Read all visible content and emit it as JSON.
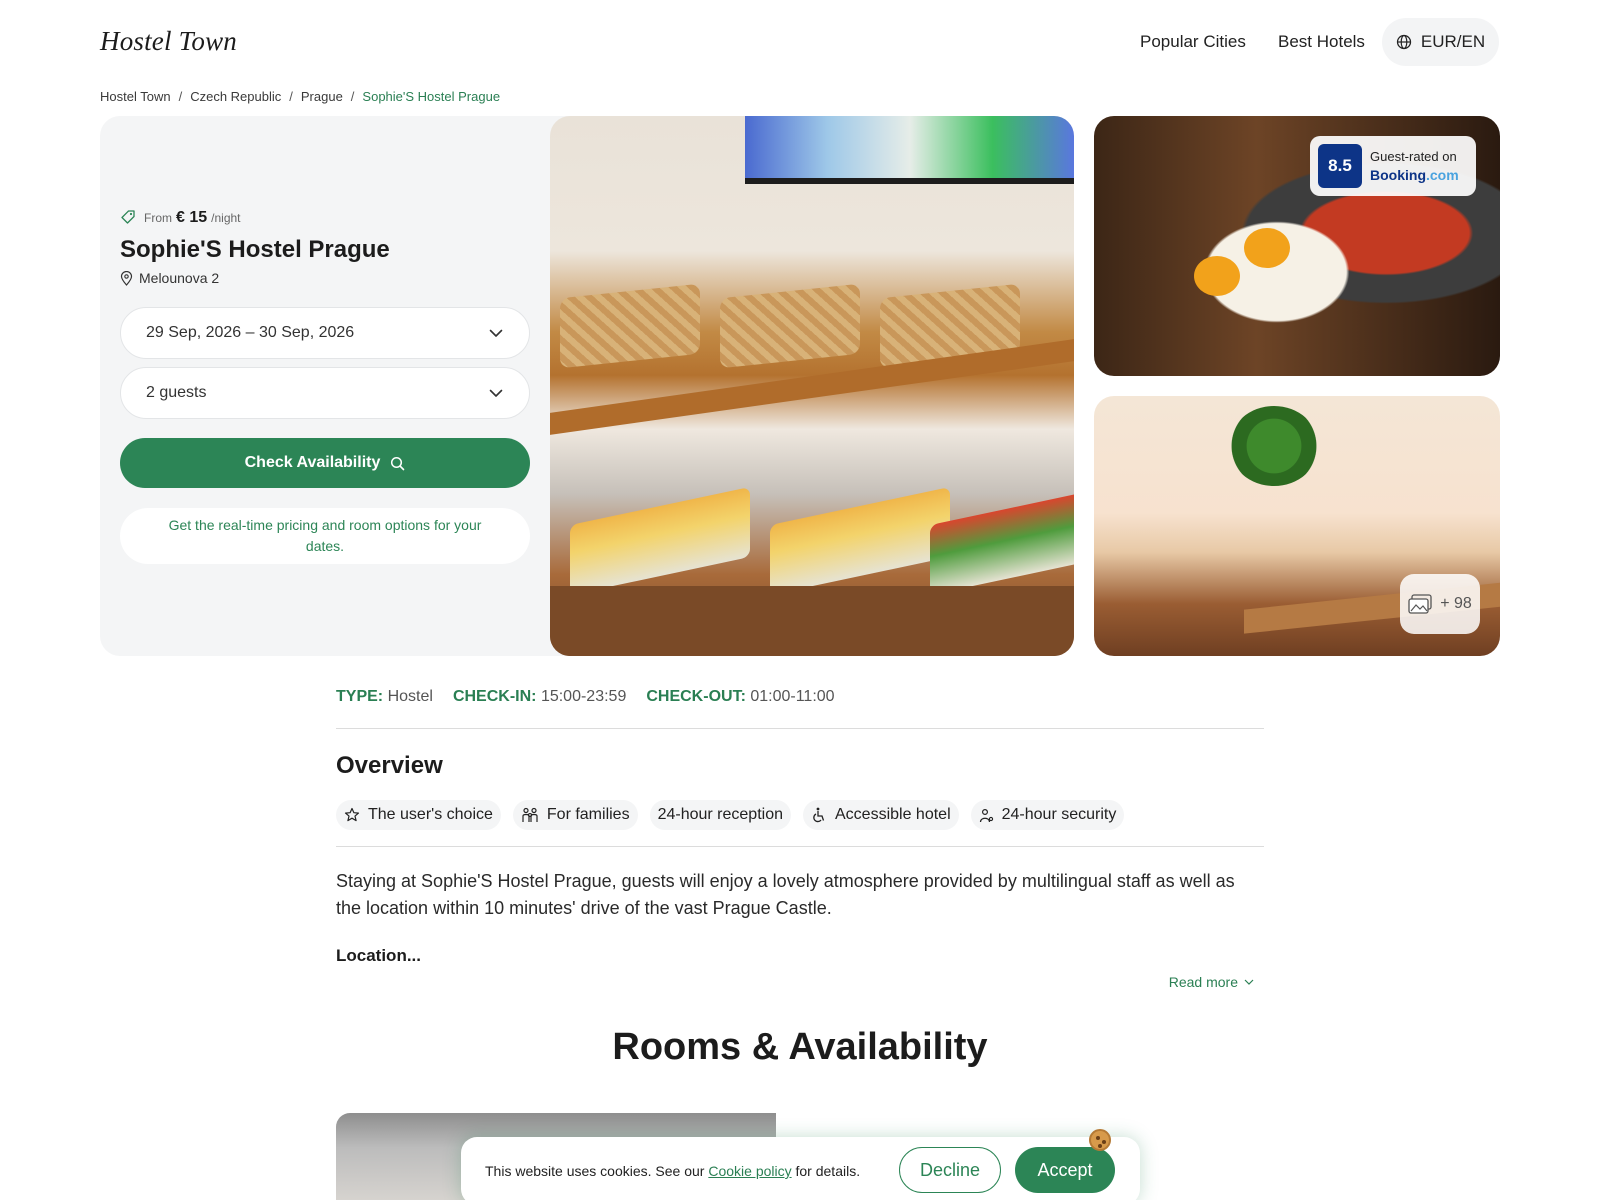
{
  "header": {
    "logo": "Hostel Town",
    "nav": [
      "Popular Cities",
      "Best Hotels"
    ],
    "lang": "EUR/EN"
  },
  "breadcrumb": [
    "Hostel Town",
    "Czech Republic",
    "Prague",
    "Sophie'S Hostel Prague"
  ],
  "booking": {
    "from_label": "From",
    "price": "€ 15",
    "per_night": "/night",
    "hotel_name": "Sophie'S Hostel Prague",
    "address": "Melounova 2",
    "dates": "29 Sep, 2026 – 30 Sep, 2026",
    "guests": "2 guests",
    "check_button": "Check Availability",
    "note": "Get the real-time pricing and room options for your dates."
  },
  "gallery": {
    "rating_score": "8.5",
    "rating_label": "Guest-rated on",
    "rating_brand": "Booking",
    "rating_brand_suffix": ".com",
    "more_count": "+ 98"
  },
  "facts": [
    {
      "key": "TYPE:",
      "value": "Hostel"
    },
    {
      "key": "CHECK-IN:",
      "value": "15:00-23:59"
    },
    {
      "key": "CHECK-OUT:",
      "value": "01:00-11:00"
    }
  ],
  "overview": {
    "title": "Overview",
    "chips": [
      {
        "icon": "star-icon",
        "label": "The user's choice"
      },
      {
        "icon": "family-icon",
        "label": "For families"
      },
      {
        "icon": "",
        "label": "24-hour reception"
      },
      {
        "icon": "accessible-icon",
        "label": "Accessible hotel"
      },
      {
        "icon": "security-icon",
        "label": "24-hour security"
      }
    ],
    "description": "Staying at Sophie'S Hostel Prague, guests will enjoy a lovely atmosphere provided by multilingual staff as well as the location within 10 minutes' drive of the vast Prague Castle.",
    "location_label": "Location...",
    "read_more": "Read more"
  },
  "rooms": {
    "title": "Rooms & Availability"
  },
  "cookie": {
    "text_before": "This website uses cookies. See our ",
    "link": "Cookie policy",
    "text_after": " for details.",
    "decline": "Decline",
    "accept": "Accept"
  },
  "colors": {
    "accent": "#2c8556",
    "booking_blue": "#0d3487",
    "panel_bg": "#f4f5f6"
  }
}
